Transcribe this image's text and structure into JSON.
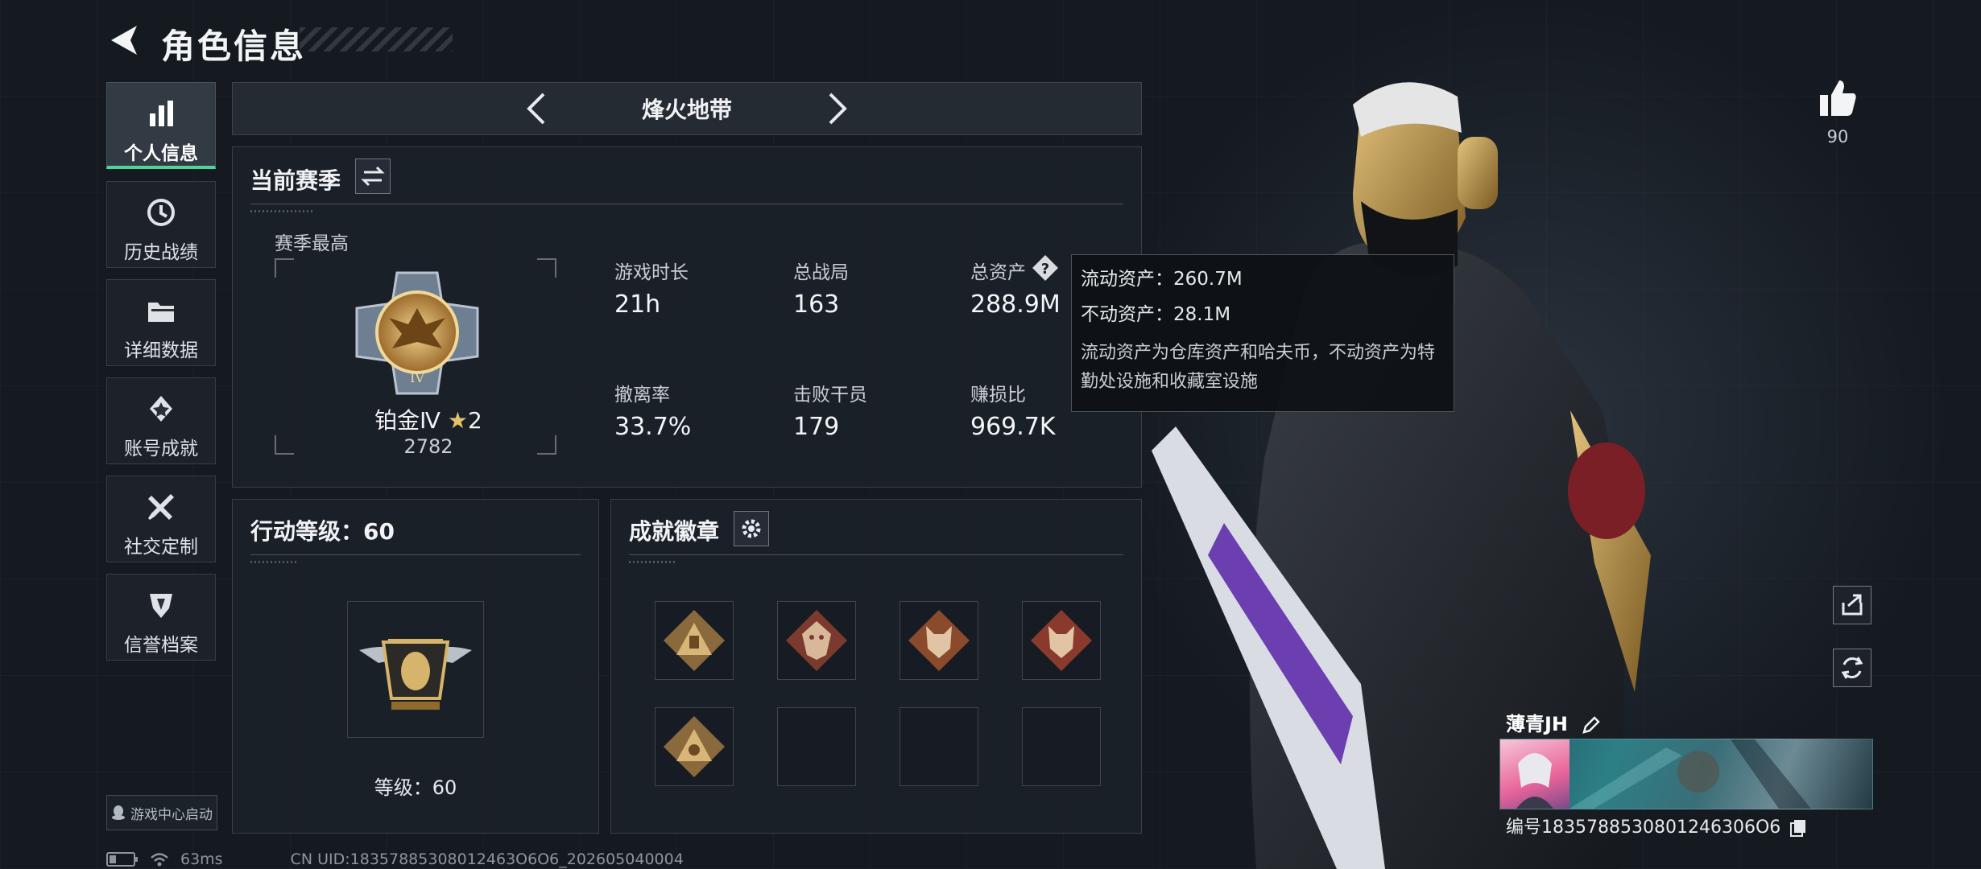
{
  "header": {
    "title": "角色信息"
  },
  "sidebar": {
    "items": [
      {
        "label": "个人信息",
        "icon": "bar-chart-icon",
        "active": true
      },
      {
        "label": "历史战绩",
        "icon": "history-icon",
        "active": false
      },
      {
        "label": "详细数据",
        "icon": "folder-icon",
        "active": false
      },
      {
        "label": "账号成就",
        "icon": "medal-icon",
        "active": false
      },
      {
        "label": "社交定制",
        "icon": "tools-icon",
        "active": false
      },
      {
        "label": "信誉档案",
        "icon": "shield-icon",
        "active": false
      }
    ],
    "launch_label": "游戏中心启动"
  },
  "mode": {
    "title": "烽火地带"
  },
  "season": {
    "title": "当前赛季",
    "best_label": "赛季最高",
    "rank_name": "铂金Ⅳ",
    "rank_stars": "2",
    "rank_score": "2782",
    "stats": [
      {
        "label": "游戏时长",
        "value": "21h"
      },
      {
        "label": "总战局",
        "value": "163"
      },
      {
        "label": "总资产",
        "value": "288.9M"
      },
      {
        "label": "撤离率",
        "value": "33.7%"
      },
      {
        "label": "击败干员",
        "value": "179"
      },
      {
        "label": "赚损比",
        "value": "969.7K"
      }
    ]
  },
  "tooltip": {
    "liquid": "流动资产：260.7M",
    "fixed": "不动资产：28.1M",
    "desc": "流动资产为仓库资产和哈夫币，不动资产为特勤处设施和收藏室设施"
  },
  "level": {
    "title": "行动等级：60",
    "label": "等级：60"
  },
  "badges": {
    "title": "成就徽章",
    "slots": [
      "triangle-badge",
      "dragon-badge",
      "wolf-badge",
      "wolf-badge",
      "triangle-badge",
      "",
      "",
      ""
    ]
  },
  "right": {
    "like_count": "90",
    "player_name": "薄青JH",
    "player_id": "编号1835788530801246306O6"
  },
  "status": {
    "ping": "63ms",
    "uid": "CN UID:18357885308012463O6O6_202605040004"
  },
  "colors": {
    "accent": "#4ad69a",
    "panel": "#1b2129",
    "gold": "#c9a24a"
  }
}
